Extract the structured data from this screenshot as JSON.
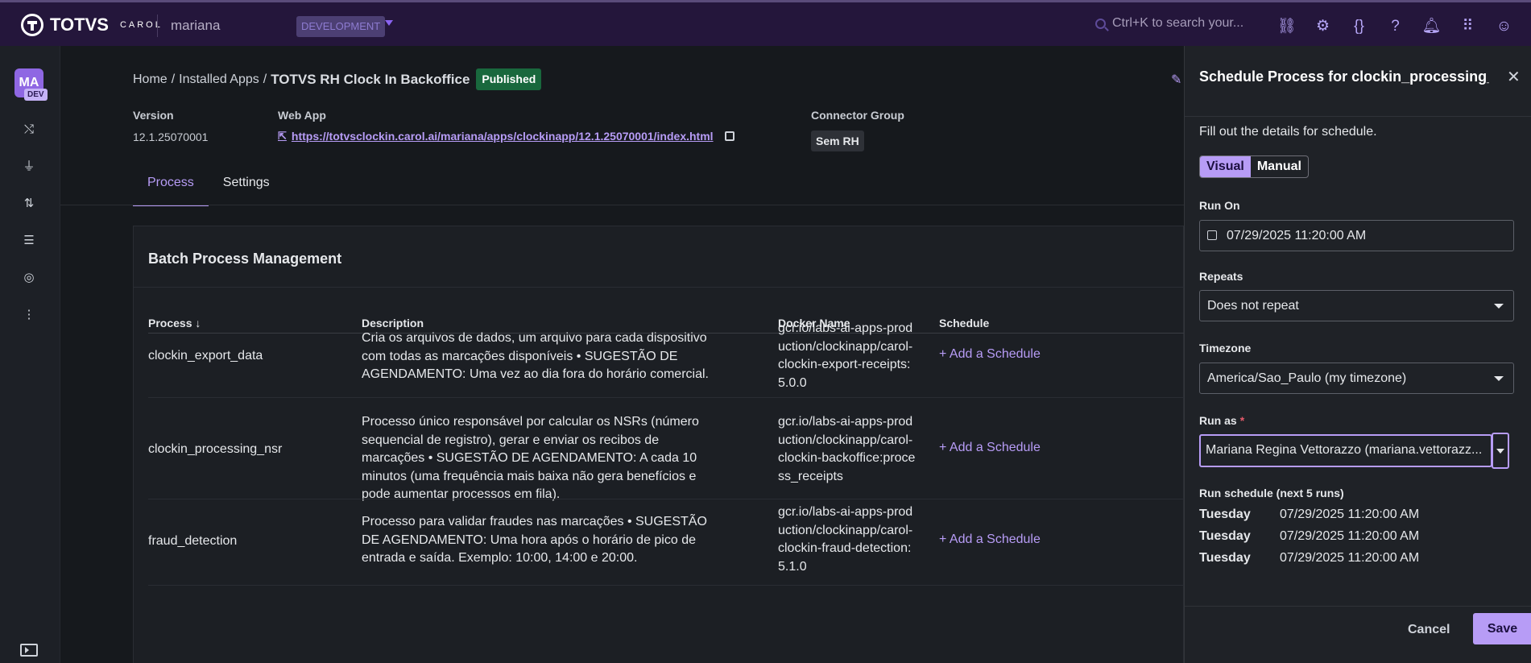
{
  "topbar": {
    "brand": "TOTVS",
    "brand_sub": "CAROL",
    "tenant": "mariana",
    "env": "DEVELOPMENT",
    "search_placeholder": "Ctrl+K to search your..."
  },
  "sidebar": {
    "avatar_initials": "MA",
    "avatar_badge": "DEV"
  },
  "breadcrumb": {
    "home": "Home",
    "installed": "Installed Apps",
    "current": "TOTVS RH Clock In Backoffice",
    "status": "Published"
  },
  "meta": {
    "version_label": "Version",
    "version_value": "12.1.25070001",
    "webapp_label": "Web App",
    "webapp_url": "https://totvsclockin.carol.ai/mariana/apps/clockinapp/12.1.25070001/index.html",
    "connector_label": "Connector Group",
    "connector_value": "Sem RH"
  },
  "tabs": [
    "Process",
    "Settings"
  ],
  "card": {
    "title": "Batch Process Management",
    "columns": [
      "Process",
      "Description",
      "Docker Name",
      "Schedule"
    ],
    "rows": [
      {
        "process": "clockin_export_data",
        "description": "Cria os arquivos de dados, um arquivo para cada dispositivo com todas as marcações disponíveis • SUGESTÃO DE AGENDAMENTO: Uma vez ao dia fora do horário comercial.",
        "docker": "gcr.io/labs-ai-apps-production/clockinapp/carol-clockin-export-receipts:5.0.0",
        "schedule": "+ Add a Schedule"
      },
      {
        "process": "clockin_processing_nsr",
        "description": "Processo único responsável por calcular os NSRs (número sequencial de registro), gerar e enviar os recibos de marcações • SUGESTÃO DE AGENDAMENTO: A cada 10 minutos (uma frequência mais baixa não gera benefícios e pode aumentar processos em fila).",
        "docker": "gcr.io/labs-ai-apps-production/clockinapp/carol-clockin-backoffice:process_receipts",
        "schedule": "+ Add a Schedule"
      },
      {
        "process": "fraud_detection",
        "description": "Processo para validar fraudes nas marcações • SUGESTÃO DE AGENDAMENTO: Uma hora após o horário de pico de entrada e saída. Exemplo: 10:00, 14:00 e 20:00.",
        "docker": "gcr.io/labs-ai-apps-production/clockinapp/carol-clockin-fraud-detection:5.1.0",
        "schedule": "+ Add a Schedule"
      }
    ]
  },
  "panel": {
    "title": "Schedule Process for clockin_processing_nsr",
    "intro": "Fill out the details for schedule.",
    "mode_visual": "Visual",
    "mode_manual": "Manual",
    "run_on_label": "Run On",
    "run_on_value": "07/29/2025 11:20:00 AM",
    "repeats_label": "Repeats",
    "repeats_value": "Does not repeat",
    "timezone_label": "Timezone",
    "timezone_value": "America/Sao_Paulo (my timezone)",
    "run_as_label": "Run as",
    "run_as_value": "Mariana Regina Vettorazzo (mariana.vettorazz...",
    "schedule_title": "Run schedule (next 5 runs)",
    "runs": [
      {
        "day": "Tuesday",
        "date": "07/29/2025 11:20:00 AM"
      },
      {
        "day": "Tuesday",
        "date": "07/29/2025 11:20:00 AM"
      },
      {
        "day": "Tuesday",
        "date": "07/29/2025 11:20:00 AM"
      }
    ],
    "cancel": "Cancel",
    "save": "Save"
  }
}
